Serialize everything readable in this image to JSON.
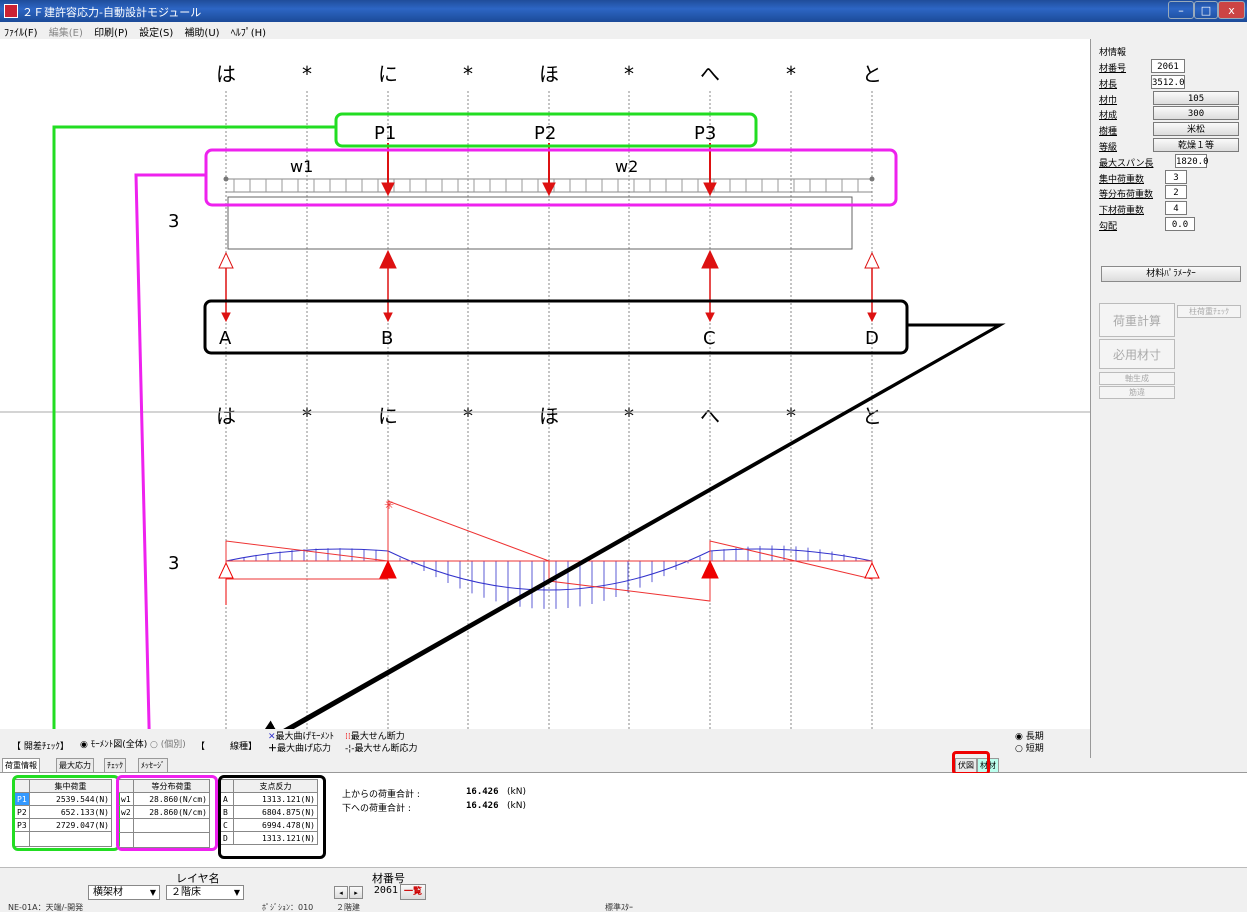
{
  "window": {
    "title": "２Ｆ建許容応力-自動設計モジュール",
    "min": "–",
    "max": "□",
    "close": "x"
  },
  "menu": [
    {
      "label": "ﾌｧｲﾙ(F)",
      "disabled": false
    },
    {
      "label": "編集(E)",
      "disabled": true
    },
    {
      "label": "印刷(P)",
      "disabled": false
    },
    {
      "label": "設定(S)",
      "disabled": false
    },
    {
      "label": "補助(U)",
      "disabled": false
    },
    {
      "label": "ﾍﾙﾌﾟ(H)",
      "disabled": false
    }
  ],
  "diagram": {
    "grid_labels": [
      "は",
      "*",
      "に",
      "*",
      "ほ",
      "*",
      "へ",
      "*",
      "と"
    ],
    "row_label": "3",
    "point_loads": [
      "P1",
      "P2",
      "P3"
    ],
    "dist_loads": [
      "w1",
      "w2"
    ],
    "supports": [
      "A",
      "B",
      "C",
      "D"
    ]
  },
  "right_panel": {
    "heading": "材情報",
    "fields": [
      {
        "label": "材番号",
        "value": "2061"
      },
      {
        "label": "材長",
        "value": "3512.0"
      },
      {
        "label": "材巾",
        "value": "105"
      },
      {
        "label": "材成",
        "value": "300"
      },
      {
        "label": "樹種",
        "value": "米松"
      },
      {
        "label": "等級",
        "value": "乾燥１等"
      },
      {
        "label": "最大スパン長",
        "value": "1820.0"
      },
      {
        "label": "集中荷重数",
        "value": "3"
      },
      {
        "label": "等分布荷重数",
        "value": "2"
      },
      {
        "label": "下材荷重数",
        "value": "4"
      },
      {
        "label": "勾配",
        "value": "0.0"
      }
    ],
    "param_button": "材料ﾊﾟﾗﾒｰﾀｰ",
    "load_calc_button": "荷重計算",
    "column_check_button": "柱荷重ﾁｪｯｸ",
    "required_size_button": "必用材寸",
    "btn_small1": "軸生成",
    "btn_small2": "筋違"
  },
  "options": {
    "display_label": "【 開差ﾁｪｯｸ】",
    "moment_all": "ﾓｰﾒﾝﾄ図(全体)",
    "moment_part": "(個別)",
    "bracket": "【",
    "line_label": "線種】",
    "legend": [
      "最大曲げﾓｰﾒﾝﾄ",
      "最大せん断力",
      "最大曲げ応力",
      "最大せん断応力"
    ],
    "long_term": "長期",
    "short_term": "短期"
  },
  "tabs": {
    "left": [
      "荷重情報",
      "最大応力",
      "ﾁｪｯｸ",
      "ﾒｯｾｰｼﾞ"
    ],
    "right": [
      "伏図",
      "材材"
    ]
  },
  "concentrated_load": {
    "header": "集中荷重",
    "rows": [
      {
        "id": "P1",
        "value": "2539.544(N)"
      },
      {
        "id": "P2",
        "value": "652.133(N)"
      },
      {
        "id": "P3",
        "value": "2729.047(N)"
      }
    ]
  },
  "distributed_load": {
    "header": "等分布荷重",
    "rows": [
      {
        "id": "w1",
        "value": "28.860(N/cm)"
      },
      {
        "id": "w2",
        "value": "28.860(N/cm)"
      }
    ]
  },
  "support_reaction": {
    "header": "支点反力",
    "rows": [
      {
        "id": "A",
        "value": "1313.121(N)"
      },
      {
        "id": "B",
        "value": "6804.875(N)"
      },
      {
        "id": "C",
        "value": "6994.478(N)"
      },
      {
        "id": "D",
        "value": "1313.121(N)"
      }
    ]
  },
  "totals": {
    "top_label": "上からの荷重合計 :",
    "top_value": "16.426",
    "bottom_label": "下への荷重合計  :",
    "bottom_value": "16.426",
    "unit": "(kN)"
  },
  "bottom": {
    "layer_label": "レイヤ名",
    "layer_type": "横架材",
    "layer_floor": "２階床",
    "member_label": "材番号",
    "member_value": "2061",
    "list_button": "一覧"
  },
  "status": {
    "s1": "NE-01A：天端/-開発",
    "s2": "ﾎﾟｼﾞｼｮﾝ：010",
    "s3": "２階建",
    "s4": "標準ｽﾀｰ"
  },
  "colors": {
    "green": "#22dd22",
    "magenta": "#ee22ee",
    "black": "#000000",
    "red": "#ee0000",
    "load_red": "#dd1111",
    "moment_blue": "#3333cc"
  }
}
